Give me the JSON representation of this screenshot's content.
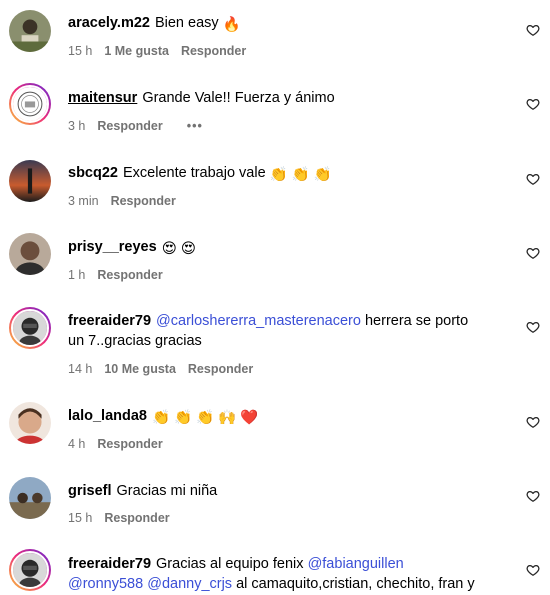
{
  "comments": [
    {
      "username": "aracely.m22",
      "text": "Bien easy",
      "emoji": "🔥",
      "time": "15 h",
      "likes": "1 Me gusta",
      "reply": "Responder"
    },
    {
      "username": "maitensur",
      "text": "Grande Vale!! Fuerza y ánimo",
      "time": "3 h",
      "reply": "Responder",
      "more": "•••"
    },
    {
      "username": "sbcq22",
      "text": "Excelente trabajo vale",
      "emoji": "👏 👏 👏",
      "time": "3 min",
      "reply": "Responder"
    },
    {
      "username": "prisy__reyes",
      "emoji": "😍 😍",
      "time": "1 h",
      "reply": "Responder"
    },
    {
      "username": "freeraider79",
      "mention": "@carloshererra_masterenacero",
      "text": "herrera se porto",
      "text2": "un 7..gracias gracias",
      "time": "14 h",
      "likes": "10 Me gusta",
      "reply": "Responder"
    },
    {
      "username": "lalo_landa8",
      "emoji": "👏 👏 👏 🙌 ❤️",
      "time": "4 h",
      "reply": "Responder"
    },
    {
      "username": "grisefl",
      "text": "Gracias mi niña",
      "time": "15 h",
      "reply": "Responder"
    },
    {
      "username": "freeraider79",
      "text": "Gracias al equipo fenix",
      "mention": "@fabianguillen",
      "mention2": "@ronny588",
      "mention3": "@danny_crjs",
      "text2": "al camaquito,cristian, chechito, fran y"
    }
  ]
}
